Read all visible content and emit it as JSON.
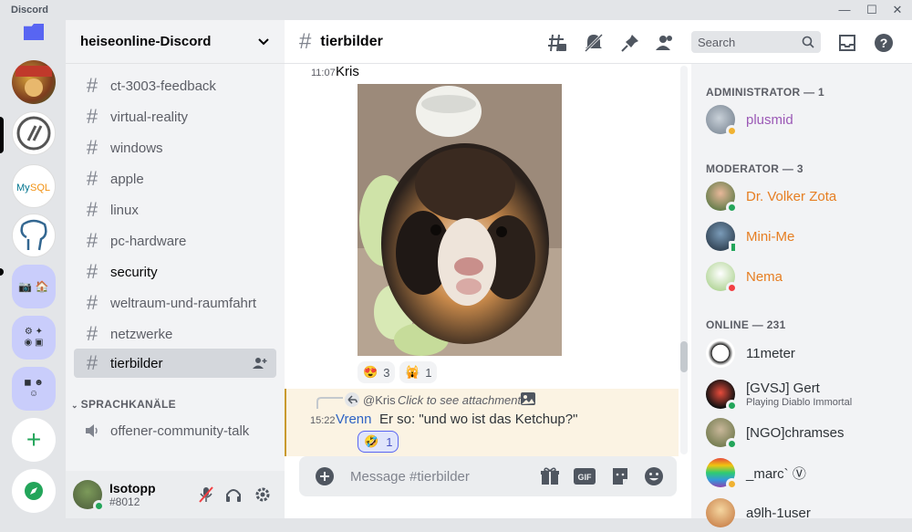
{
  "window": {
    "app_name": "Discord",
    "minimize": "—",
    "maximize": "☐",
    "close": "✕"
  },
  "guild": {
    "name": "heiseonline-Discord"
  },
  "channels": [
    {
      "name": "ct-3003-feedback"
    },
    {
      "name": "virtual-reality"
    },
    {
      "name": "windows"
    },
    {
      "name": "apple"
    },
    {
      "name": "linux"
    },
    {
      "name": "pc-hardware"
    },
    {
      "name": "security"
    },
    {
      "name": "weltraum-und-raumfahrt"
    },
    {
      "name": "netzwerke"
    },
    {
      "name": "tierbilder"
    }
  ],
  "voice_category": "SPRACHKANÄLE",
  "voice_channel": "offener-community-talk",
  "user": {
    "name": "Isotopp",
    "tag": "#8012"
  },
  "header": {
    "channel": "tierbilder",
    "search_placeholder": "Search"
  },
  "messages": {
    "first": {
      "time": "11:07",
      "author": "Kris"
    },
    "reactions": [
      {
        "emoji": "😍",
        "count": "3"
      },
      {
        "emoji": "🙀",
        "count": "1"
      }
    ],
    "reply": {
      "ref_user": "@Kris",
      "ref_text": "Click to see attachment",
      "time": "15:22",
      "author": "Vrenn",
      "text": "Er so: \"und wo ist das Ketchup?\"",
      "reaction_emoji": "🤣",
      "reaction_count": "1"
    }
  },
  "composer": {
    "placeholder": "Message #tierbilder"
  },
  "members": {
    "admin_header": "ADMINISTRATOR — 1",
    "mod_header": "MODERATOR — 3",
    "online_header": "ONLINE — 231",
    "admins": [
      {
        "name": "plusmid",
        "color": "#9b59b6"
      }
    ],
    "mods": [
      {
        "name": "Dr. Volker Zota",
        "color": "#e67e22"
      },
      {
        "name": "Mini-Me",
        "color": "#e67e22"
      },
      {
        "name": "Nema",
        "color": "#e67e22"
      }
    ],
    "online": [
      {
        "name": "11meter",
        "activity": ""
      },
      {
        "name": "[GVSJ] Gert",
        "activity": "Playing Diablo Immortal"
      },
      {
        "name": "[NGO]chramses",
        "activity": ""
      },
      {
        "name": "_marc` Ⓥ",
        "activity": ""
      },
      {
        "name": "a9lh-1user",
        "activity": ""
      }
    ]
  },
  "colors": {
    "accent": "#5865f2",
    "online": "#23a55a",
    "idle": "#f0b232",
    "dnd": "#f23f43"
  }
}
